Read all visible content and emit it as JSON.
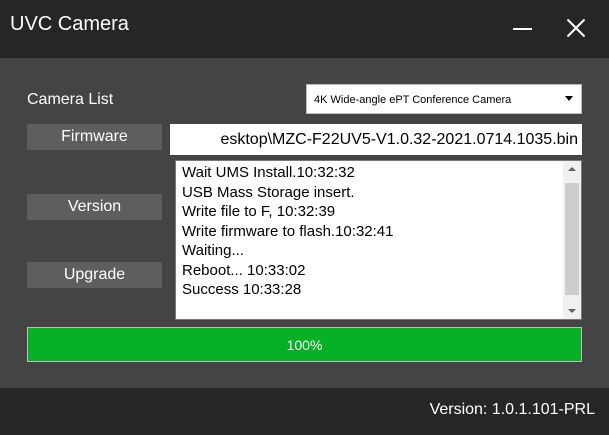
{
  "window": {
    "title": "UVC Camera"
  },
  "camera": {
    "label": "Camera List",
    "selected": "4K Wide-angle ePT Conference Camera"
  },
  "buttons": {
    "firmware": "Firmware",
    "version": "Version",
    "upgrade": "Upgrade"
  },
  "firmware_path": "esktop\\MZC-F22UV5-V1.0.32-2021.0714.1035.bin",
  "log": [
    "Wait UMS Install.10:32:32",
    "USB Mass Storage insert.",
    "Write file to F, 10:32:39",
    "Write firmware to flash.10:32:41",
    "Waiting...",
    "Reboot... 10:33:02",
    "Success 10:33:28"
  ],
  "progress": {
    "value": 100,
    "label": "100%"
  },
  "footer": {
    "version": "Version: 1.0.1.101-PRL"
  },
  "colors": {
    "titlebar": "#262626",
    "body": "#444444",
    "button": "#5e5e5e",
    "progress_fill": "#06b025"
  },
  "icons": {
    "minimize": "minimize-icon",
    "close": "close-icon",
    "dropdown": "chevron-down-icon"
  }
}
